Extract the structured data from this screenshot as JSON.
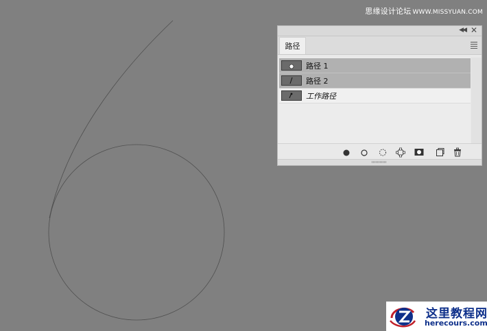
{
  "watermark": {
    "cn_text": "思缘设计论坛",
    "url_text": "WWW.MISSYUAN.COM"
  },
  "canvas": {
    "background_color": "#808080",
    "path_color": "#4e4e4e"
  },
  "panel": {
    "tab_label": "路径",
    "collapse_icon": "double-chevron-left-icon",
    "close_icon": "close-icon",
    "menu_icon": "panel-menu-icon",
    "paths": [
      {
        "name": "路径 1",
        "selected": true,
        "thumbnail_icon": "circle-path-thumbnail-icon",
        "italic": false
      },
      {
        "name": "路径 2",
        "selected": true,
        "thumbnail_icon": "line-path-thumbnail-icon",
        "italic": false
      },
      {
        "name": "工作路径",
        "selected": false,
        "thumbnail_icon": "work-path-thumbnail-icon",
        "italic": true
      }
    ],
    "footer_buttons": [
      {
        "name": "fill-path-button",
        "icon": "filled-circle-icon"
      },
      {
        "name": "stroke-path-button",
        "icon": "hollow-circle-icon"
      },
      {
        "name": "load-as-selection-button",
        "icon": "dotted-circle-icon"
      },
      {
        "name": "make-work-path-button",
        "icon": "path-from-selection-icon"
      },
      {
        "name": "add-mask-button",
        "icon": "mask-icon"
      },
      {
        "name": "new-path-button",
        "icon": "new-page-icon"
      },
      {
        "name": "delete-path-button",
        "icon": "trash-icon"
      }
    ]
  },
  "brand": {
    "name": "这里教程网",
    "url": "herecours.com",
    "accent_color": "#0d2f8a",
    "secondary_color": "#c0202a"
  }
}
